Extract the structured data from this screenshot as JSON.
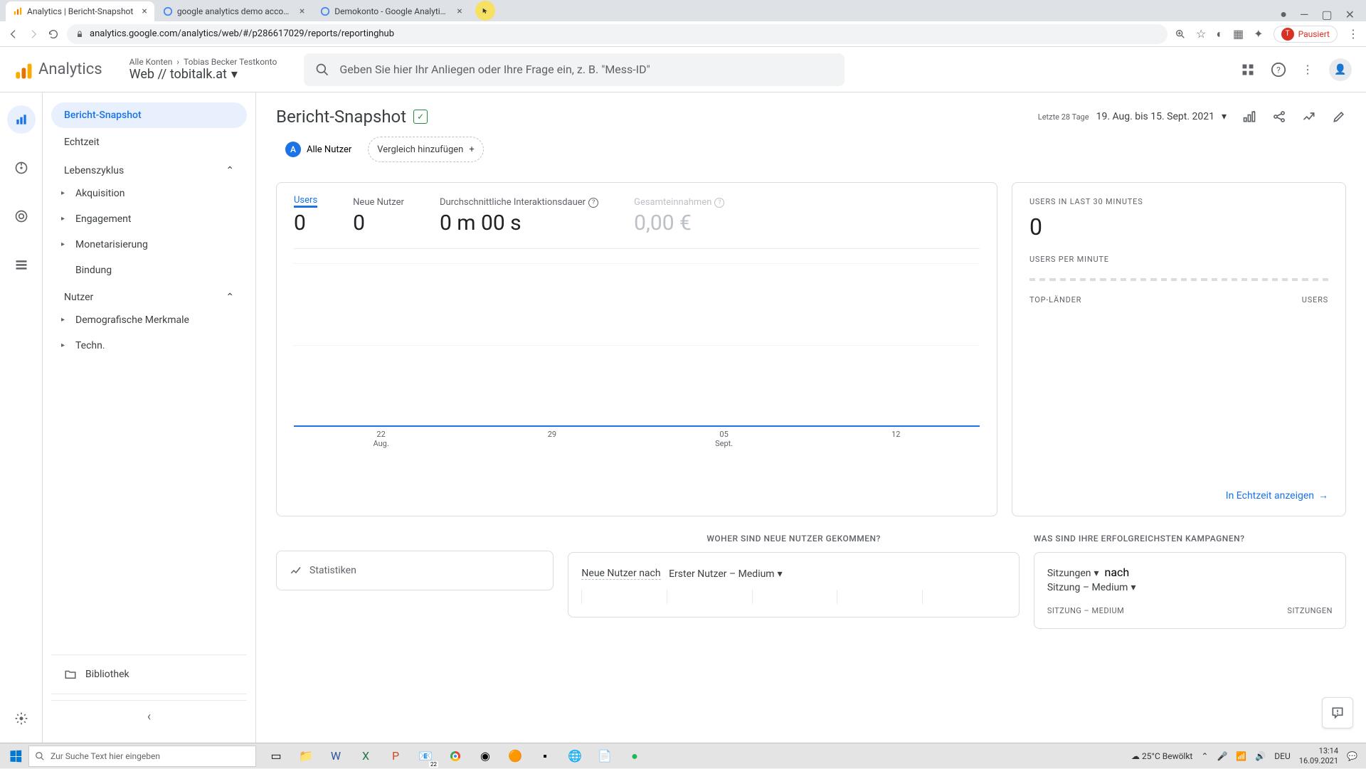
{
  "browser": {
    "tabs": [
      {
        "title": "Analytics | Bericht-Snapshot"
      },
      {
        "title": "google analytics demo account"
      },
      {
        "title": "Demokonto - Google Analytics-H"
      }
    ],
    "url": "analytics.google.com/analytics/web/#/p286617029/reports/reportinghub",
    "paused": "Pausiert",
    "win": {
      "min": "—",
      "max": "▢",
      "close": "✕"
    }
  },
  "ga_header": {
    "logo": "Analytics",
    "breadcrumb_all": "Alle Konten",
    "breadcrumb_account": "Tobias Becker Testkonto",
    "property": "Web // tobitalk.at",
    "search_placeholder": "Geben Sie hier Ihr Anliegen oder Ihre Frage ein, z. B. \"Mess-ID\""
  },
  "sidenav": {
    "items_primary": [
      "Bericht-Snapshot",
      "Echtzeit"
    ],
    "section_life": "Lebenszyklus",
    "life_items": [
      "Akquisition",
      "Engagement",
      "Monetarisierung",
      "Bindung"
    ],
    "section_user": "Nutzer",
    "user_items": [
      "Demografische Merkmale",
      "Techn."
    ],
    "library": "Bibliothek"
  },
  "page": {
    "title": "Bericht-Snapshot",
    "date_label": "Letzte 28 Tage",
    "date_range": "19. Aug. bis 15. Sept. 2021",
    "segment_all": "Alle Nutzer",
    "segment_add": "Vergleich hinzufügen"
  },
  "chart_data": {
    "type": "line",
    "metrics": [
      {
        "label": "Users",
        "value": "0",
        "active": true
      },
      {
        "label": "Neue Nutzer",
        "value": "0"
      },
      {
        "label": "Durchschnittliche Interaktionsdauer",
        "value": "0 m 00 s",
        "help": true
      },
      {
        "label": "Gesamteinnahmen",
        "value": "0,00 €",
        "muted": true,
        "help": true
      }
    ],
    "x_ticks": [
      {
        "day": "22",
        "month": "Aug."
      },
      {
        "day": "29",
        "month": ""
      },
      {
        "day": "05",
        "month": "Sept."
      },
      {
        "day": "12",
        "month": ""
      }
    ],
    "series": [
      {
        "name": "Users",
        "values": [
          0,
          0,
          0,
          0,
          0,
          0,
          0,
          0,
          0,
          0,
          0,
          0,
          0,
          0,
          0,
          0,
          0,
          0,
          0,
          0,
          0,
          0,
          0,
          0,
          0,
          0,
          0,
          0
        ]
      }
    ],
    "ylim": [
      0,
      1
    ]
  },
  "realtime": {
    "title_users": "USERS IN LAST 30 MINUTES",
    "value": "0",
    "title_perminute": "USERS PER MINUTE",
    "col_country": "TOP-LÄNDER",
    "col_users": "USERS",
    "link": "In Echtzeit anzeigen"
  },
  "lower": {
    "acquisition_heading": "WOHER SIND NEUE NUTZER GEKOMMEN?",
    "campaign_heading": "WAS SIND IHRE ERFOLGREICHSTEN KAMPAGNEN?",
    "stats_label": "Statistiken",
    "new_users_by": "Neue Nutzer nach",
    "first_user_medium": "Erster Nutzer – Medium",
    "sessions": "Sitzungen",
    "by": "nach",
    "session_medium": "Sitzung – Medium",
    "col_session_medium": "SITZUNG – MEDIUM",
    "col_sessions": "SITZUNGEN"
  },
  "taskbar": {
    "search_placeholder": "Zur Suche Text hier eingeben",
    "weather_temp": "25°C",
    "weather_desc": "Bewölkt",
    "lang": "DEU",
    "time": "13:14",
    "date": "16.09.2021",
    "chrome_badge": "22"
  }
}
